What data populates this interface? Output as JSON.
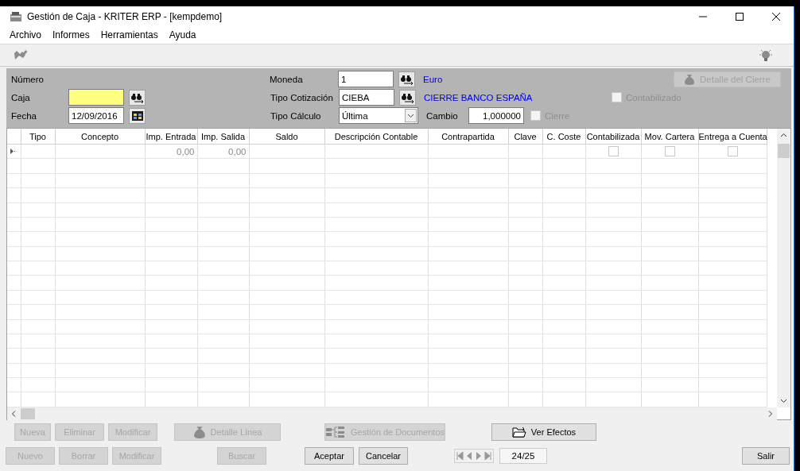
{
  "window": {
    "title": "Gestión de Caja - KRITER ERP - [kempdemo]"
  },
  "menu": [
    "Archivo",
    "Informes",
    "Herramientas",
    "Ayuda"
  ],
  "form": {
    "numero": {
      "label": "Número"
    },
    "caja": {
      "label": "Caja"
    },
    "fecha": {
      "label": "Fecha",
      "value": "12/09/2016"
    },
    "moneda": {
      "label": "Moneda",
      "value": "1",
      "description": "Euro"
    },
    "tipo_cotizacion": {
      "label": "Tipo Cotización",
      "value": "CIEBA",
      "description": "CIERRE BANCO ESPAÑA"
    },
    "tipo_calculo": {
      "label": "Tipo Cálculo",
      "value": "Última"
    },
    "cambio": {
      "label": "Cambio",
      "value": "1,000000"
    },
    "cierre": {
      "label": "Cierre",
      "checked": false,
      "disabled": true
    },
    "detalle_cierre": {
      "label": "Detalle del Cierre",
      "disabled": true
    },
    "contabilizado": {
      "label": "Contabilizado",
      "checked": false,
      "disabled": true
    }
  },
  "table": {
    "columns": [
      "Tipo",
      "Concepto",
      "Imp. Entrada",
      "Imp. Salida",
      "Saldo",
      "Descripción Contable",
      "Contrapartida",
      "Clave",
      "C. Coste",
      "Contabilizada",
      "Mov. Cartera",
      "Entrega a Cuenta"
    ],
    "rows": [
      {
        "current": true,
        "imp_entrada": "0,00",
        "imp_salida": "0,00",
        "contabilizada": false,
        "mov_cartera": false,
        "entrega_a_cuenta": false
      }
    ]
  },
  "line_buttons": [
    {
      "label": "Nueva",
      "disabled": true,
      "kind": "plain"
    },
    {
      "label": "Eliminar",
      "disabled": true,
      "kind": "plain"
    },
    {
      "label": "Modificar",
      "disabled": true,
      "kind": "plain"
    },
    {
      "label": "Detalle Línea",
      "disabled": true,
      "kind": "bag"
    },
    {
      "label": "Gestión de Documentos",
      "disabled": true,
      "kind": "tree"
    },
    {
      "label": "Ver Efectos",
      "disabled": false,
      "kind": "folder"
    }
  ],
  "bottom_buttons": [
    {
      "label": "Nuevo",
      "disabled": true
    },
    {
      "label": "Borrar",
      "disabled": true
    },
    {
      "label": "Modificar",
      "disabled": true
    },
    {
      "label": "Buscar",
      "disabled": true
    },
    {
      "label": "Aceptar",
      "disabled": false
    },
    {
      "label": "Cancelar",
      "disabled": false
    }
  ],
  "record_counter": "24/25",
  "exit_button": {
    "label": "Salir",
    "disabled": false
  }
}
